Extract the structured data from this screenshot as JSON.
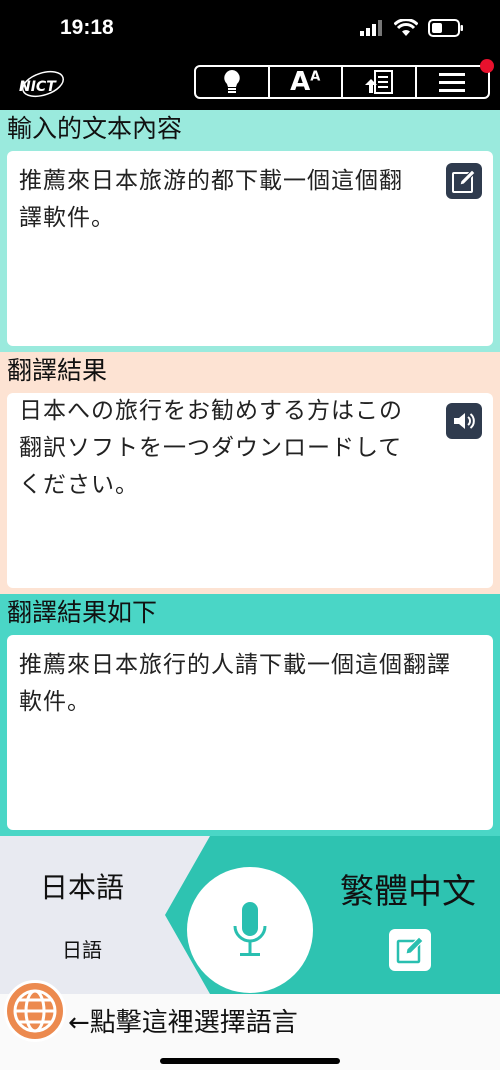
{
  "status": {
    "time": "19:18"
  },
  "appbar": {
    "logo_text": "NICT",
    "tools": [
      {
        "icon": "lightbulb-icon"
      },
      {
        "icon": "font-size-icon",
        "label": "A",
        "superscript": "A"
      },
      {
        "icon": "upload-checklist-icon"
      },
      {
        "icon": "menu-icon",
        "has_notification": true
      }
    ]
  },
  "input": {
    "title": "輸入的文本內容",
    "text": "推薦來日本旅游的都下載一個這個翻譯軟件。"
  },
  "result": {
    "title": "翻譯結果",
    "text": "日本への旅行をお勧めする方はこの翻訳ソフトを一つダウンロードしてください。"
  },
  "back_translation": {
    "title": "翻譯結果如下",
    "text": "推薦來日本旅行的人請下載一個這個翻譯軟件。"
  },
  "languages": {
    "source_name": "日本語",
    "source_native": "日語",
    "target_name": "繁體中文"
  },
  "footer": {
    "hint": "←點擊這裡選擇語言"
  },
  "colors": {
    "input_bg": "#9aeadd",
    "result_bg": "#fde3d3",
    "back_bg": "#4ad6c6",
    "lang_bar_bg": "#2ec3b1",
    "globe": "#ec8a4f"
  }
}
